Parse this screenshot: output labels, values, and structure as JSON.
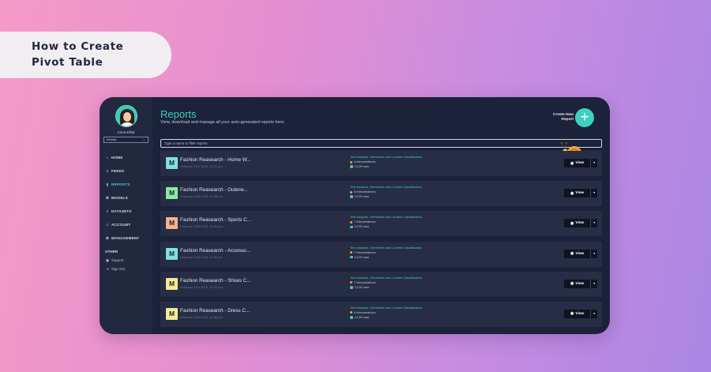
{
  "banner": {
    "line1": "How to Create",
    "line2": "Pivot Table"
  },
  "sidebar": {
    "user_name": "Anna Elliot",
    "org": "Kimola",
    "nav": [
      {
        "label": "HOME",
        "icon": "home-icon",
        "glyph": "⌂"
      },
      {
        "label": "FEEDS",
        "icon": "feeds-icon",
        "glyph": "≈"
      },
      {
        "label": "REPORTS",
        "icon": "reports-icon",
        "glyph": "▮"
      },
      {
        "label": "MODELS",
        "icon": "models-icon",
        "glyph": "⚙"
      },
      {
        "label": "DATASETS",
        "icon": "datasets-icon",
        "glyph": "≡"
      },
      {
        "label": "ACCOUNT",
        "icon": "account-icon",
        "glyph": "☺"
      },
      {
        "label": "MANAGEMENT",
        "icon": "management-icon",
        "glyph": "⚙"
      }
    ],
    "other_label": "OTHER",
    "other": [
      {
        "label": "Support",
        "icon": "support-icon",
        "glyph": "▣"
      },
      {
        "label": "Sign Out",
        "icon": "sign-out-icon",
        "glyph": "⇥"
      }
    ]
  },
  "main": {
    "title": "Reports",
    "subtitle": "View, download and manage all your auto-generated reports here.",
    "create_line1": "Create New",
    "create_line2": "Report",
    "create_glyph": "+",
    "filter_placeholder": "Type a name to filter reports"
  },
  "reports": [
    {
      "badge": "M",
      "badge_color": "#7fe3d6",
      "name": "Fashion Reasearch - Home W...",
      "date": "February 24th 2025, 10:31 pm",
      "type": "Text Analysis, Sentiment and Content Classification",
      "interpretations": "4 Interpretations",
      "rows": "3,125 rows"
    },
    {
      "badge": "M",
      "badge_color": "#8ee9a6",
      "name": "Fashion Reasearch - Outerw...",
      "date": "February 24th 2025, 10:48 pm",
      "type": "Text Analysis, Sentiment and Content Classification",
      "interpretations": "6 Interpretations",
      "rows": "3,125 rows"
    },
    {
      "badge": "M",
      "badge_color": "#f6b389",
      "name": "Fashion Reasearch - Sports C...",
      "date": "February 24th 2025, 10:44 pm",
      "type": "Text Analysis, Sentiment and Content Classification",
      "interpretations": "7 Interpretations",
      "rows": "3,125 rows"
    },
    {
      "badge": "M",
      "badge_color": "#7fe3d6",
      "name": "Fashion Reasearch - Accesso...",
      "date": "February 24th 2025, 10:40 pm",
      "type": "Text Analysis, Sentiment and Content Classification",
      "interpretations": "7 Interpretations",
      "rows": "3,125 rows"
    },
    {
      "badge": "M",
      "badge_color": "#f7ea8e",
      "name": "Fashion Reasearch - Shoes C...",
      "date": "February 24th 2025, 10:43 pm",
      "type": "Text Analysis, Sentiment and Content Classification",
      "interpretations": "7 Interpretations",
      "rows": "3,125 rows"
    },
    {
      "badge": "M",
      "badge_color": "#f7ea8e",
      "name": "Fashion Reasearch - Dress C...",
      "date": "February 24th 2025, 10:36 pm",
      "type": "Text Analysis, Sentiment and Content Classification",
      "interpretations": "6 Interpretations",
      "rows": "3,125 rows"
    }
  ],
  "view_label": "View",
  "colors": {
    "accent": "#3fcfc0",
    "panel": "#1b2239",
    "sidebar": "#22293f",
    "row": "#262d45"
  }
}
